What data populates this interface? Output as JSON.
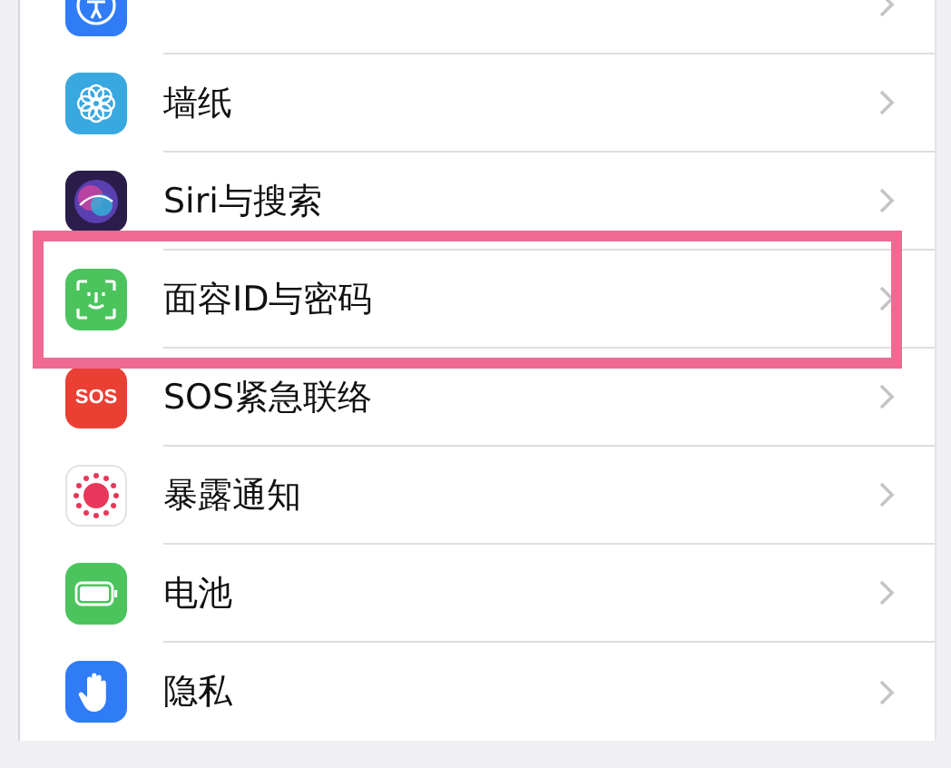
{
  "settings_items": [
    {
      "color": "#2f7cf6",
      "highlighted": false
    },
    {
      "label": "墙纸",
      "color": "#3aa8e0",
      "highlighted": false
    },
    {
      "label": "Siri与搜索",
      "color": "#2a1d4a",
      "highlighted": false
    },
    {
      "label": "面容ID与密码",
      "color": "#4cc45e",
      "highlighted": true
    },
    {
      "label": "SOS紧急联络",
      "color": "#ea3f33",
      "icon_text": "SOS",
      "highlighted": false
    },
    {
      "label": "暴露通知",
      "color": "#ffffff",
      "highlighted": false
    },
    {
      "label": "电池",
      "color": "#4cc45e",
      "highlighted": false
    },
    {
      "label": "隐私",
      "color": "#2f7cf6",
      "highlighted": false
    }
  ]
}
